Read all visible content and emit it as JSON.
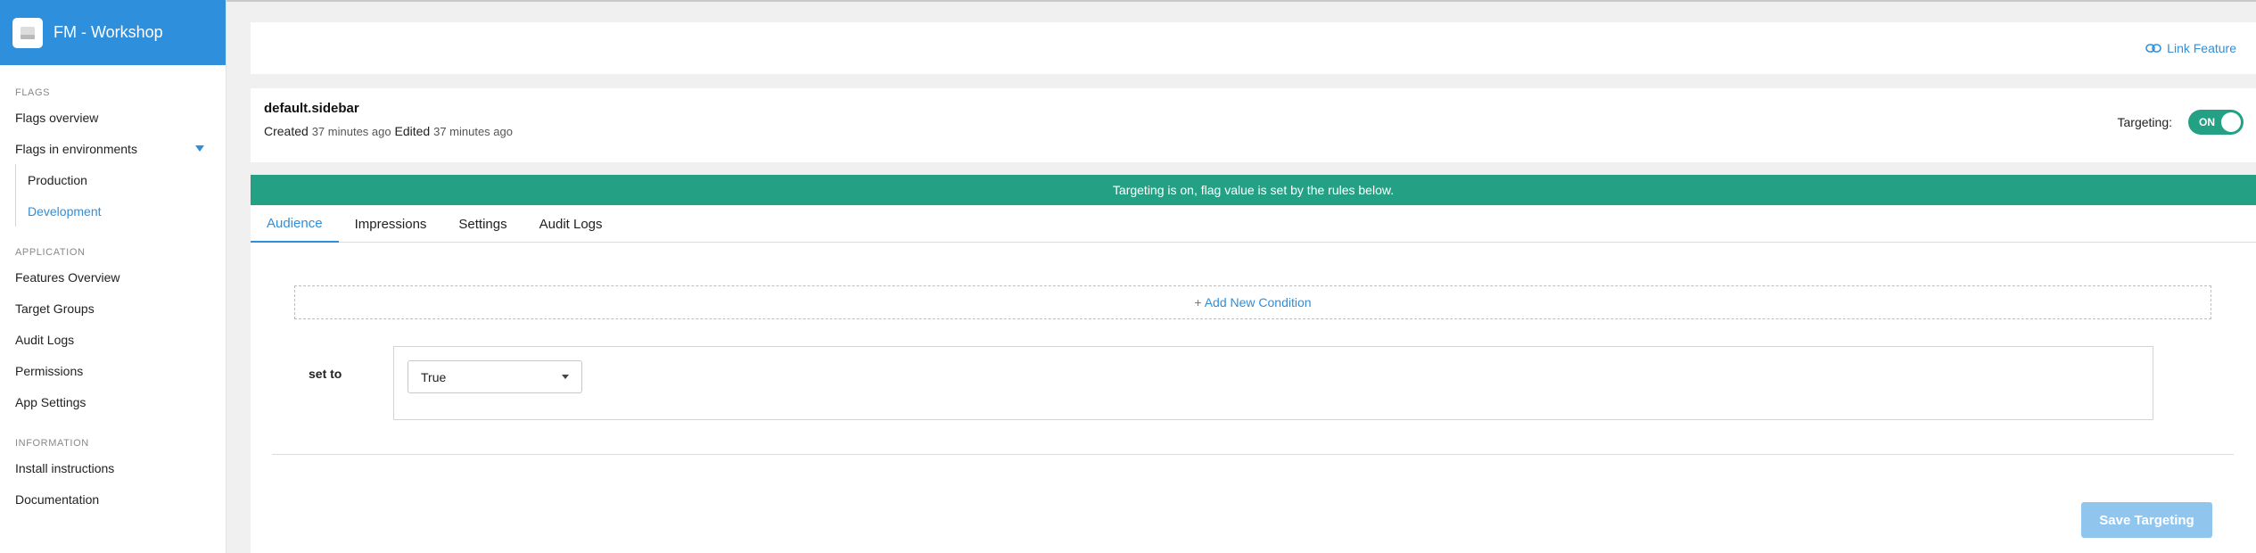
{
  "app": {
    "title": "FM - Workshop",
    "logo_icon": "app-logo-icon"
  },
  "sidebar": {
    "sections": [
      {
        "label": "FLAGS",
        "items": [
          "Flags overview",
          "Flags in environments"
        ]
      },
      {
        "label": "APPLICATION",
        "items": [
          "Features Overview",
          "Target Groups",
          "Audit Logs",
          "Permissions",
          "App Settings"
        ]
      },
      {
        "label": "INFORMATION",
        "items": [
          "Install instructions",
          "Documentation"
        ]
      }
    ],
    "environments": [
      "Production",
      "Development"
    ],
    "active_environment": "Development"
  },
  "header": {
    "link_feature": "Link Feature",
    "link_icon": "link-icon"
  },
  "flag": {
    "name": "default.sidebar",
    "created_label": "Created",
    "created_value": "37 minutes ago",
    "edited_label": "Edited",
    "edited_value": "37 minutes ago",
    "targeting_label": "Targeting:",
    "targeting_state": "ON"
  },
  "banner": {
    "text": "Targeting is on, flag value is set by the rules below."
  },
  "tabs": [
    "Audience",
    "Impressions",
    "Settings",
    "Audit Logs"
  ],
  "active_tab": "Audience",
  "audience": {
    "add_condition": "+ Add New Condition",
    "set_to_label": "set to",
    "selected_value": "True",
    "save_button": "Save Targeting"
  },
  "colors": {
    "accent": "#2e8fdc",
    "success": "#24a185",
    "save_disabled": "#90c5ee"
  }
}
